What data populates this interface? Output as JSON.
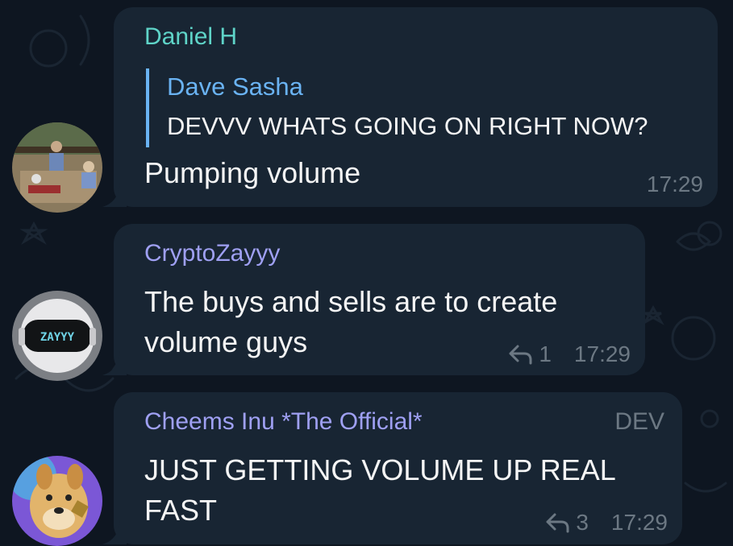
{
  "messages": [
    {
      "sender": "Daniel H",
      "sender_color": "#5fd4c8",
      "reply": {
        "name": "Dave Sasha",
        "text": "DEVVV WHATS GOING ON RIGHT NOW?"
      },
      "text_lines": [
        "Pumping volume"
      ],
      "time": "17:29"
    },
    {
      "sender": "CryptoZayyy",
      "sender_color": "#9fa0f3",
      "avatar_text": "ZAYYY",
      "text_lines": [
        "The buys and sells are to create",
        "volume guys"
      ],
      "reply_count": "1",
      "time": "17:29"
    },
    {
      "sender": "Cheems Inu *The Official*",
      "sender_color": "#9fa0f3",
      "badge": "DEV",
      "text_lines": [
        "JUST GETTING VOLUME UP REAL",
        "FAST"
      ],
      "reply_count": "3",
      "time": "17:29"
    }
  ],
  "colors": {
    "background": "#0e1621",
    "bubble": "#182533",
    "quote_accent": "#6ab3f3",
    "meta": "#6c7883"
  },
  "icons": [
    "reply-arrow-icon"
  ]
}
